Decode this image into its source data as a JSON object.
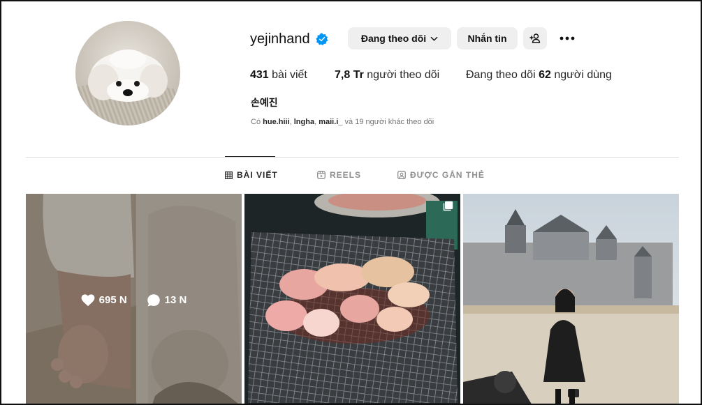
{
  "profile": {
    "username": "yejinhand",
    "full_name": "손예진",
    "stats": {
      "posts_count": "431",
      "posts_label": "bài viết",
      "followers_count": "7,8 Tr",
      "followers_label": "người theo dõi",
      "following_prefix": "Đang theo dõi",
      "following_count": "62",
      "following_label": "người dùng"
    },
    "followed_by": {
      "prefix": "Có",
      "users": [
        "hue.hiii",
        "lngha",
        "maii.i_"
      ],
      "suffix": "và 19 người khác theo dõi"
    }
  },
  "actions": {
    "following_label": "Đang theo dõi",
    "message_label": "Nhắn tin"
  },
  "tabs": [
    {
      "label": "BÀI VIẾT",
      "icon": "grid-icon",
      "active": true
    },
    {
      "label": "REELS",
      "icon": "reels-icon",
      "active": false
    },
    {
      "label": "ĐƯỢC GẮN THẺ",
      "icon": "tagged-icon",
      "active": false
    }
  ],
  "posts": [
    {
      "likes": "695 N",
      "comments": "13 N",
      "hovered": true,
      "description": "baby foot and dog paw"
    },
    {
      "multi": true,
      "description": "grilled meat on grill"
    },
    {
      "description": "woman in front of chateau"
    }
  ],
  "colors": {
    "verified_blue": "#0095f6",
    "button_bg": "#efefef",
    "divider": "#dbdbdb",
    "muted_text": "#737373"
  }
}
